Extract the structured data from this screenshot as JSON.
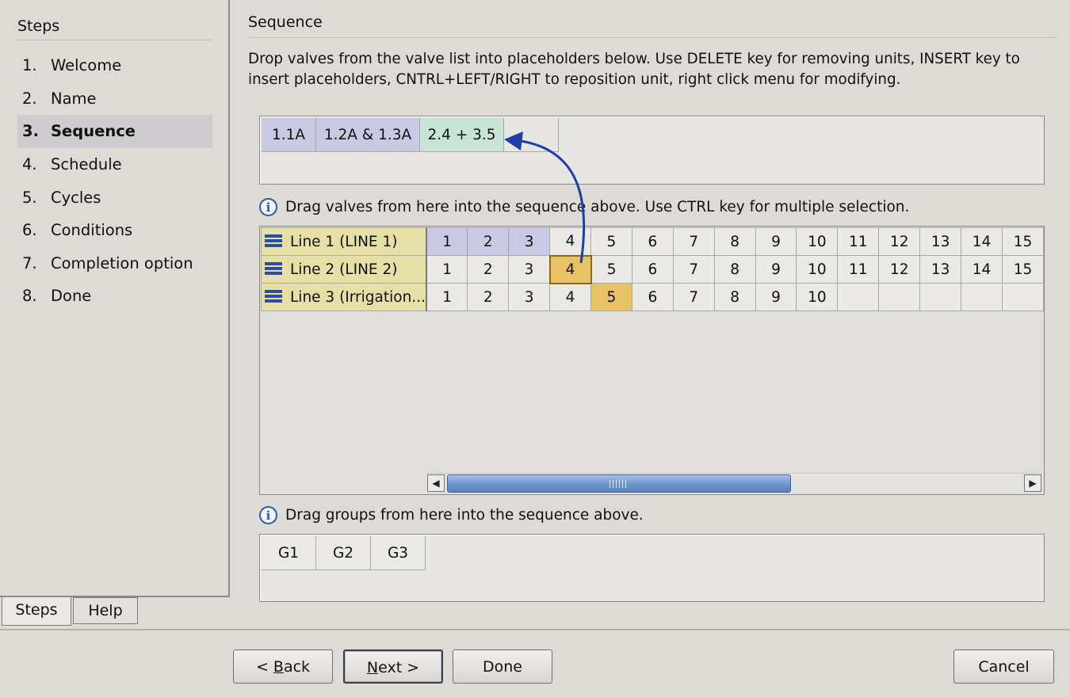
{
  "steps_panel": {
    "heading": "Steps",
    "items": [
      {
        "num": "1.",
        "label": "Welcome"
      },
      {
        "num": "2.",
        "label": "Name"
      },
      {
        "num": "3.",
        "label": "Sequence"
      },
      {
        "num": "4.",
        "label": "Schedule"
      },
      {
        "num": "5.",
        "label": "Cycles"
      },
      {
        "num": "6.",
        "label": "Conditions"
      },
      {
        "num": "7.",
        "label": "Completion option"
      },
      {
        "num": "8.",
        "label": "Done"
      }
    ],
    "active_index": 2,
    "tabs": [
      "Steps",
      "Help"
    ]
  },
  "main": {
    "title": "Sequence",
    "instructions": "Drop valves from the valve list into placeholders below. Use DELETE key for removing units, INSERT key to insert placeholders, CNTRL+LEFT/RIGHT to reposition unit, right click menu for modifying.",
    "sequence_chips": [
      "1.1A",
      "1.2A & 1.3A",
      "2.4 + 3.5",
      ""
    ],
    "valves_hint": "Drag valves from here into the sequence above. Use CTRL key for multiple selection.",
    "valve_lines": [
      {
        "label": "Line 1 (LINE  1)",
        "valves": [
          "1",
          "2",
          "3",
          "4",
          "5",
          "6",
          "7",
          "8",
          "9",
          "10",
          "11",
          "12",
          "13",
          "14",
          "15"
        ]
      },
      {
        "label": "Line 2 (LINE  2)",
        "valves": [
          "1",
          "2",
          "3",
          "4",
          "5",
          "6",
          "7",
          "8",
          "9",
          "10",
          "11",
          "12",
          "13",
          "14",
          "15"
        ]
      },
      {
        "label": "Line 3 (Irrigation...",
        "valves": [
          "1",
          "2",
          "3",
          "4",
          "5",
          "6",
          "7",
          "8",
          "9",
          "10",
          "",
          "",
          "",
          "",
          ""
        ]
      }
    ],
    "groups_hint": "Drag groups from here into the sequence above.",
    "group_chips": [
      "G1",
      "G2",
      "G3"
    ]
  },
  "buttons": {
    "back_prefix": "< ",
    "back_mnemonic": "B",
    "back_rest": "ack",
    "next_mnemonic": "N",
    "next_rest": "ext >",
    "done": "Done",
    "cancel": "Cancel"
  },
  "colors": {
    "used_valve": "#c9c9e4",
    "selected_valve": "#e8c264",
    "line_header": "#e6e0a6",
    "arrow": "#1f3fa8"
  }
}
